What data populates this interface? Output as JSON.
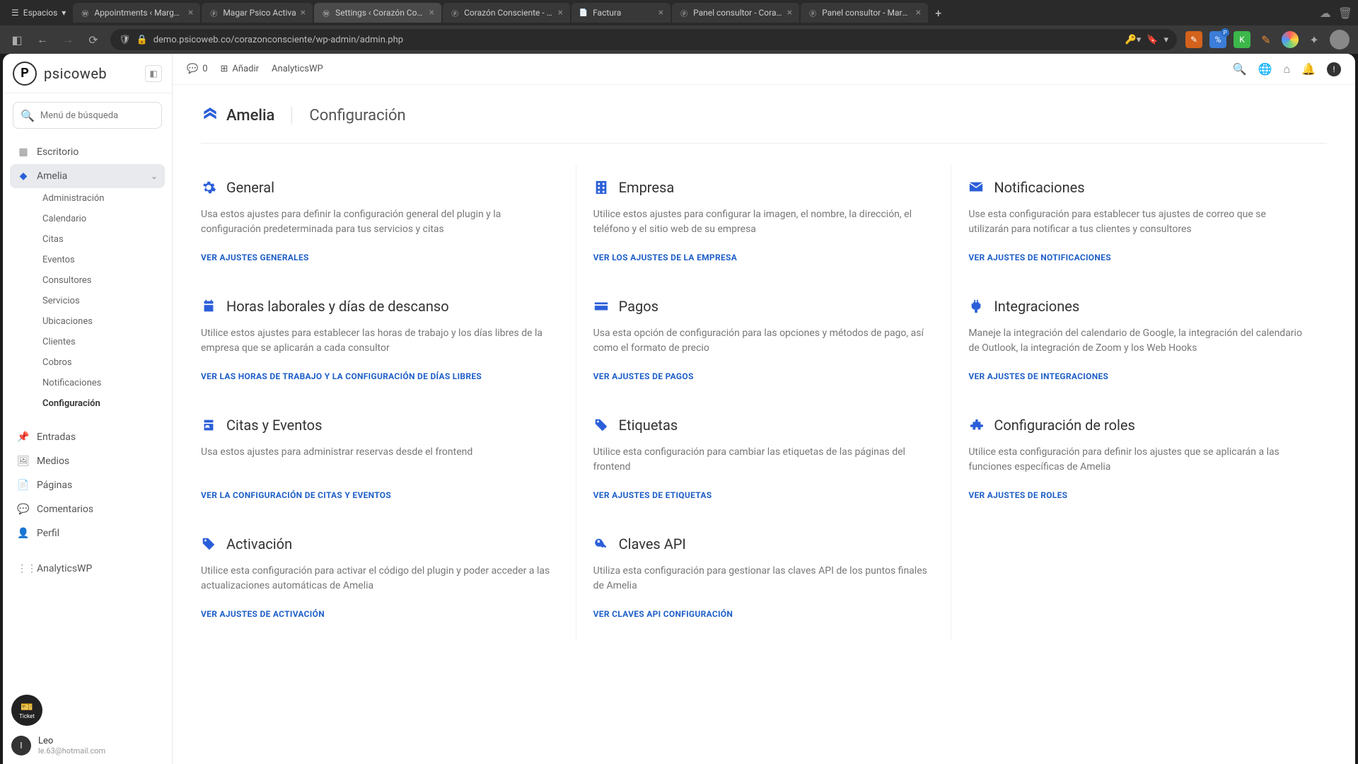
{
  "browser": {
    "tab_group": "Espacios",
    "tabs": [
      {
        "label": "Appointments ‹ Marga Ps",
        "favicon": "wp"
      },
      {
        "label": "Magar Psico Activa",
        "favicon": "p"
      },
      {
        "label": "Settings ‹ Corazón Cons",
        "favicon": "wp",
        "active": true
      },
      {
        "label": "Corazón Consciente - Des",
        "favicon": "p"
      },
      {
        "label": "Factura",
        "favicon": "doc"
      },
      {
        "label": "Panel consultor - Corazón",
        "favicon": "p"
      },
      {
        "label": "Panel consultor - Marga P",
        "favicon": "p"
      }
    ],
    "url": "demo.psicoweb.co/corazonconsciente/wp-admin/admin.php"
  },
  "app": {
    "brand": "psicoweb",
    "search_placeholder": "Menú de búsqueda",
    "nav": {
      "desktop": "Escritorio",
      "amelia": "Amelia",
      "amelia_sub": [
        "Administración",
        "Calendario",
        "Citas",
        "Eventos",
        "Consultores",
        "Servicios",
        "Ubicaciones",
        "Clientes",
        "Cobros",
        "Notificaciones",
        "Configuración"
      ],
      "entries": "Entradas",
      "media": "Medios",
      "pages": "Páginas",
      "comments": "Comentarios",
      "profile": "Perfil",
      "analytics": "AnalyticsWP"
    },
    "ticket_label": "Ticket",
    "user": {
      "name": "Leo",
      "email": "le.63@hotmail.com",
      "initial": "l"
    }
  },
  "topbar": {
    "comments_count": "0",
    "add": "Añadir",
    "analytics": "AnalyticsWP"
  },
  "page": {
    "plugin": "Amelia",
    "title": "Configuración",
    "cards": [
      {
        "icon": "gear",
        "title": "General",
        "desc": "Usa estos ajustes para definir la configuración general del plugin y la configuración predeterminada para tus servicios y citas",
        "link": "VER AJUSTES GENERALES"
      },
      {
        "icon": "building",
        "title": "Empresa",
        "desc": "Utilice estos ajustes para configurar la imagen, el nombre, la dirección, el teléfono y el sitio web de su empresa",
        "link": "VER LOS AJUSTES DE LA EMPRESA"
      },
      {
        "icon": "mail",
        "title": "Notificaciones",
        "desc": "Use esta configuración para establecer tus ajustes de correo que se utilizarán para notificar a tus clientes y consultores",
        "link": "VER AJUSTES DE NOTIFICACIONES"
      },
      {
        "icon": "calendar",
        "title": "Horas laborales y días de descanso",
        "desc": "Utilice estos ajustes para establecer las horas de trabajo y los días libres de la empresa que se aplicarán a cada consultor",
        "link": "VER LAS HORAS DE TRABAJO Y LA CONFIGURACIÓN DE DÍAS LIBRES"
      },
      {
        "icon": "card",
        "title": "Pagos",
        "desc": "Usa esta opción de configuración para las opciones y métodos de pago, así como el formato de precio",
        "link": "VER AJUSTES DE PAGOS"
      },
      {
        "icon": "plug",
        "title": "Integraciones",
        "desc": "Maneje la integración del calendario de Google, la integración del calendario de Outlook, la integración de Zoom y los Web Hooks",
        "link": "VER AJUSTES DE INTEGRACIONES"
      },
      {
        "icon": "event",
        "title": "Citas y Eventos",
        "desc": "Usa estos ajustes para administrar reservas desde el frontend",
        "link": "VER LA CONFIGURACIÓN DE CITAS Y EVENTOS"
      },
      {
        "icon": "tags",
        "title": "Etiquetas",
        "desc": "Utilice esta configuración para cambiar las etiquetas de las páginas del frontend",
        "link": "VER AJUSTES DE ETIQUETAS"
      },
      {
        "icon": "puzzle",
        "title": "Configuración de roles",
        "desc": "Utilice esta configuración para definir los ajustes que se aplicarán a las funciones específicas de Amelia",
        "link": "VER AJUSTES DE ROLES"
      },
      {
        "icon": "tag",
        "title": "Activación",
        "desc": "Utilice esta configuración para activar el código del plugin y poder acceder a las actualizaciones automáticas de Amelia",
        "link": "VER AJUSTES DE ACTIVACIÓN"
      },
      {
        "icon": "key",
        "title": "Claves API",
        "desc": "Utiliza esta configuración para gestionar las claves API de los puntos finales de Amelia",
        "link": "VER CLAVES API CONFIGURACIÓN"
      }
    ]
  }
}
